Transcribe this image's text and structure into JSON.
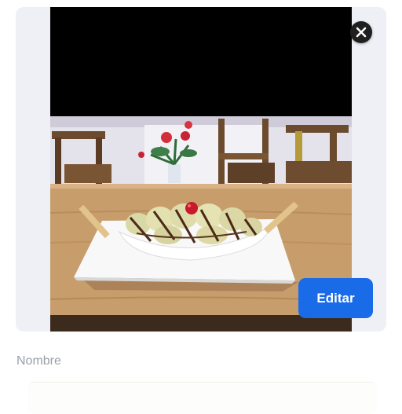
{
  "form": {
    "edit_label": "Editar",
    "name_label": "Nombre",
    "name_value": ""
  },
  "icons": {
    "close": "close-icon"
  },
  "colors": {
    "accent": "#1a6be8",
    "card_background": "#eef0f6",
    "close_button": "#1f1f1f",
    "label_text": "#9aa0aa"
  }
}
